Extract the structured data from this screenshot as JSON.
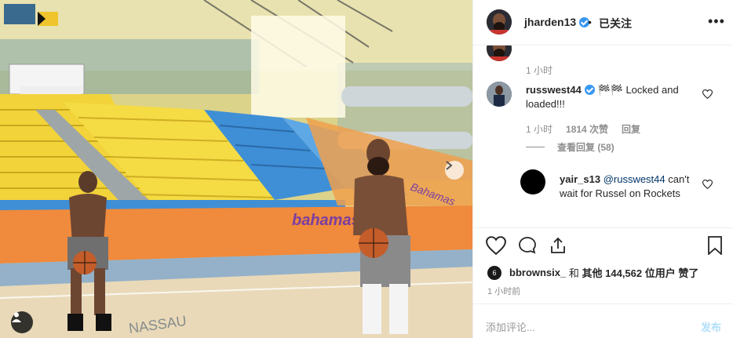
{
  "photo": {
    "banner_text_1": "bahamas",
    "banner_text_2": "Bahamas",
    "floor_text": "NASSAU"
  },
  "header": {
    "username": "jharden13",
    "separator": "•",
    "follow_status": "已关注",
    "more_label": "•••"
  },
  "comments": {
    "first_time": "1 小时",
    "main_comment": {
      "username": "russwest44",
      "emoji": "🏁🏁",
      "text": "Locked and loaded!!!",
      "time": "1 小时",
      "likes": "1814 次赞",
      "reply_label": "回复",
      "view_replies": "查看回复 (58)"
    },
    "reply": {
      "username": "yair_s13",
      "mention": "@russwest44",
      "text": "can't wait for Russel on Rockets"
    }
  },
  "liked_by": {
    "avatar_letter": "6",
    "first_user": "bbrownsix_",
    "connector": "和",
    "others": "其他 144,562 位用户",
    "suffix": "赞了"
  },
  "post_time": "1 小时前",
  "add_comment": {
    "placeholder": "添加评论...",
    "post_label": "发布"
  },
  "colors": {
    "accent_blue": "#3897f0",
    "post_disabled": "#b2dffc",
    "seat_yellow": "#f2d33a",
    "seat_blue": "#3f8fd6",
    "banner_orange": "#f08a3c"
  },
  "icons": [
    "next-arrow-icon",
    "user-tag-icon",
    "heart-icon",
    "comment-icon",
    "share-icon",
    "bookmark-icon",
    "verified-badge-icon",
    "small-heart-icon"
  ]
}
